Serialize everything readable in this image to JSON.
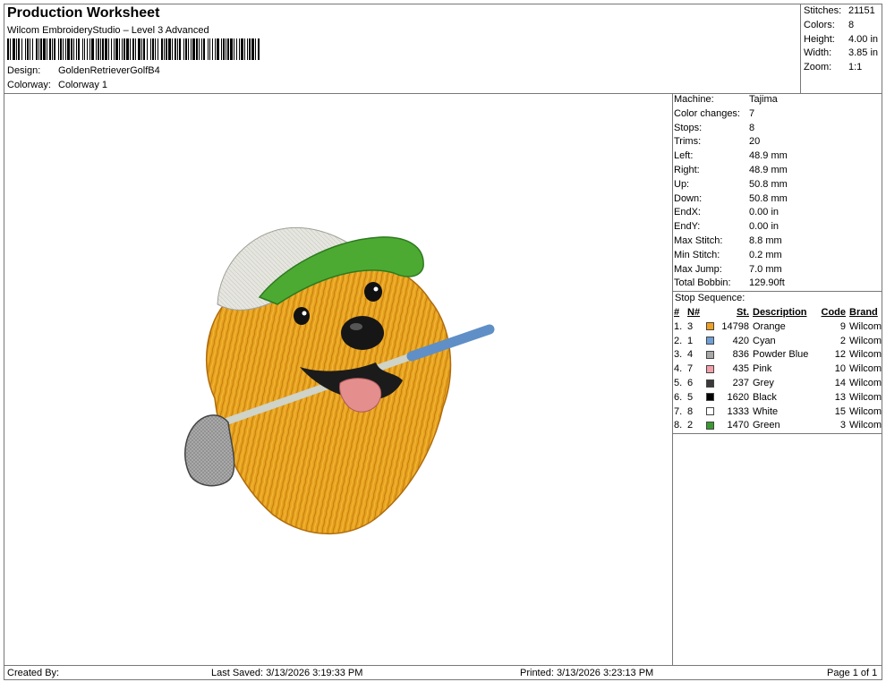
{
  "header": {
    "title": "Production Worksheet",
    "subtitle": "Wilcom EmbroideryStudio – Level 3 Advanced",
    "design_label": "Design:",
    "design_value": "GoldenRetrieverGolfB4",
    "colorway_label": "Colorway:",
    "colorway_value": "Colorway 1"
  },
  "summary": [
    {
      "label": "Stitches:",
      "value": "21151"
    },
    {
      "label": "Colors:",
      "value": "8"
    },
    {
      "label": "Height:",
      "value": "4.00 in"
    },
    {
      "label": "Width:",
      "value": "3.85 in"
    },
    {
      "label": "Zoom:",
      "value": "1:1"
    }
  ],
  "machine_stats": [
    {
      "label": "Machine:",
      "value": "Tajima"
    },
    {
      "label": "Color changes:",
      "value": "7"
    },
    {
      "label": "Stops:",
      "value": "8"
    },
    {
      "label": "Trims:",
      "value": "20"
    },
    {
      "label": "Left:",
      "value": "48.9 mm"
    },
    {
      "label": "Right:",
      "value": "48.9 mm"
    },
    {
      "label": "Up:",
      "value": "50.8 mm"
    },
    {
      "label": "Down:",
      "value": "50.8 mm"
    },
    {
      "label": "EndX:",
      "value": "0.00 in"
    },
    {
      "label": "EndY:",
      "value": "0.00 in"
    },
    {
      "label": "Max Stitch:",
      "value": "8.8 mm"
    },
    {
      "label": "Min Stitch:",
      "value": "0.2 mm"
    },
    {
      "label": "Max Jump:",
      "value": "7.0 mm"
    },
    {
      "label": "Total Bobbin:",
      "value": "129.90ft"
    }
  ],
  "stop_sequence": {
    "title": "Stop Sequence:",
    "headers": {
      "num": "#",
      "n": "N#",
      "st": "St.",
      "desc": "Description",
      "code": "Code",
      "brand": "Brand"
    },
    "rows": [
      {
        "num": "1.",
        "n": "3",
        "color": "#f0a020",
        "st": "14798",
        "desc": "Orange",
        "code": "9",
        "brand": "Wilcom"
      },
      {
        "num": "2.",
        "n": "1",
        "color": "#6f9fd6",
        "st": "420",
        "desc": "Cyan",
        "code": "2",
        "brand": "Wilcom"
      },
      {
        "num": "3.",
        "n": "4",
        "color": "#a8a8a8",
        "st": "836",
        "desc": "Powder Blue",
        "code": "12",
        "brand": "Wilcom"
      },
      {
        "num": "4.",
        "n": "7",
        "color": "#f0a0a8",
        "st": "435",
        "desc": "Pink",
        "code": "10",
        "brand": "Wilcom"
      },
      {
        "num": "5.",
        "n": "6",
        "color": "#3a3a3a",
        "st": "237",
        "desc": "Grey",
        "code": "14",
        "brand": "Wilcom"
      },
      {
        "num": "6.",
        "n": "5",
        "color": "#000000",
        "st": "1620",
        "desc": "Black",
        "code": "13",
        "brand": "Wilcom"
      },
      {
        "num": "7.",
        "n": "8",
        "color": "#ffffff",
        "st": "1333",
        "desc": "White",
        "code": "15",
        "brand": "Wilcom"
      },
      {
        "num": "8.",
        "n": "2",
        "color": "#3a9a30",
        "st": "1470",
        "desc": "Green",
        "code": "3",
        "brand": "Wilcom"
      }
    ]
  },
  "footer": {
    "created_by": "Created By:",
    "last_saved": "Last Saved: 3/13/2026 3:19:33 PM",
    "printed": "Printed: 3/13/2026 3:23:13 PM",
    "page": "Page 1 of 1"
  }
}
